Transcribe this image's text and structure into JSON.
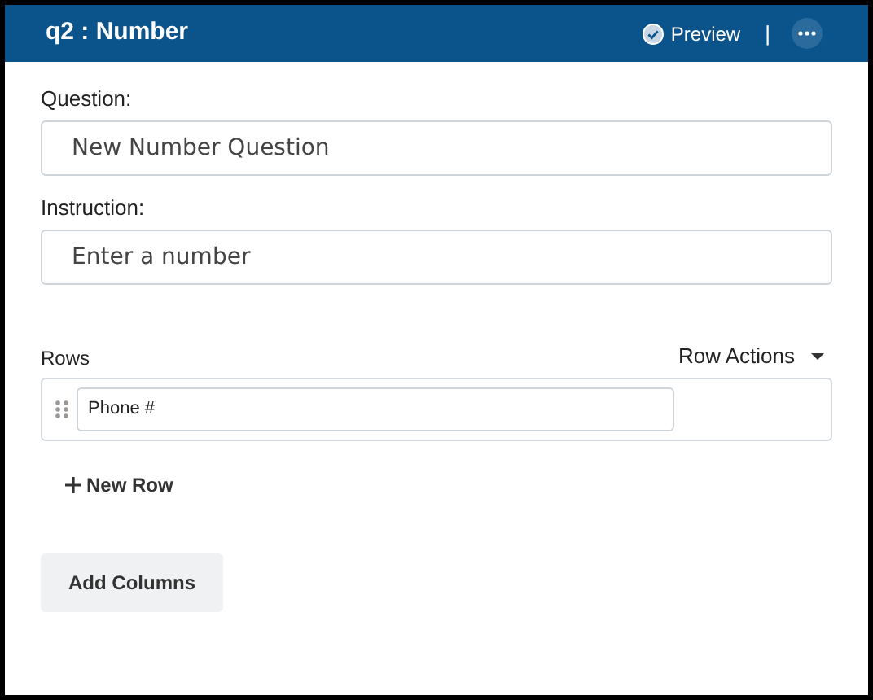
{
  "header": {
    "title": "q2 : Number",
    "preview": "Preview",
    "separator": "|"
  },
  "question": {
    "label": "Question:",
    "value": "New Number Question"
  },
  "instruction": {
    "label": "Instruction:",
    "value": "Enter a number"
  },
  "rows": {
    "label": "Rows",
    "actions": "Row Actions",
    "items": [
      {
        "value": "Phone #"
      }
    ],
    "new_row": "New Row"
  },
  "add_columns": "Add Columns"
}
